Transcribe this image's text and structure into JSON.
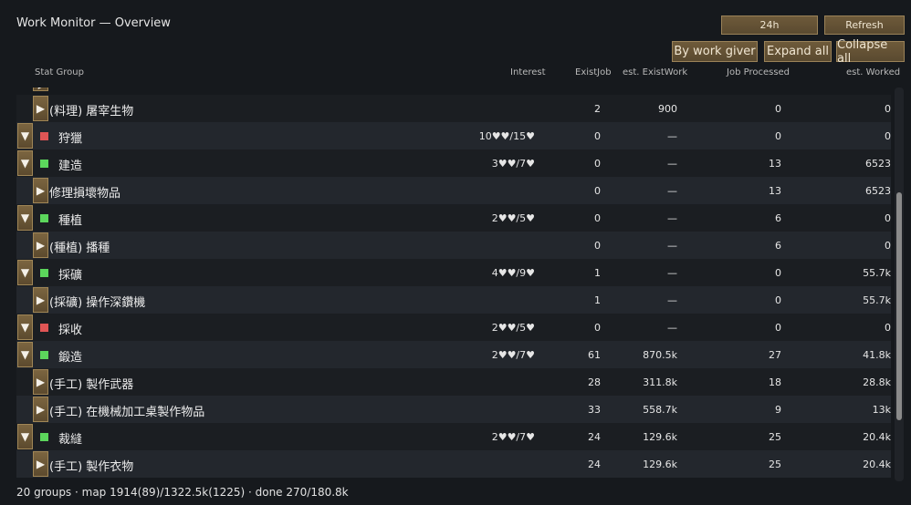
{
  "title": "Work Monitor — Overview",
  "buttons": {
    "period": "24h",
    "refresh": "Refresh",
    "by_giver": "By work giver",
    "expand": "Expand all",
    "collapse": "Collapse all"
  },
  "headers": {
    "group": "Stat Group",
    "interest": "Interest",
    "existjob": "ExistJob",
    "est_existwork": "est. ExistWork",
    "job_processed": "Job Processed",
    "est_worked": "est. Worked"
  },
  "colors": {
    "status_red": "#e05555",
    "status_green": "#5cd65c"
  },
  "rows": [
    {
      "type": "child",
      "name": "(料理) 屠宰生物",
      "existjob": "2",
      "existwork": "900",
      "processed": "0",
      "worked": "0"
    },
    {
      "type": "group",
      "status": "red",
      "name": "狩獵",
      "interest": "10♥♥/15♥",
      "existjob": "0",
      "existwork": "—",
      "processed": "0",
      "worked": "0"
    },
    {
      "type": "group",
      "status": "green",
      "name": "建造",
      "interest": "3♥♥/7♥",
      "existjob": "0",
      "existwork": "—",
      "processed": "13",
      "worked": "6523"
    },
    {
      "type": "child",
      "name": "修理損壞物品",
      "existjob": "0",
      "existwork": "—",
      "processed": "13",
      "worked": "6523"
    },
    {
      "type": "group",
      "status": "green",
      "name": "種植",
      "interest": "2♥♥/5♥",
      "existjob": "0",
      "existwork": "—",
      "processed": "6",
      "worked": "0"
    },
    {
      "type": "child",
      "name": "(種植) 播種",
      "existjob": "0",
      "existwork": "—",
      "processed": "6",
      "worked": "0"
    },
    {
      "type": "group",
      "status": "green",
      "name": "採礦",
      "interest": "4♥♥/9♥",
      "existjob": "1",
      "existwork": "—",
      "processed": "0",
      "worked": "55.7k"
    },
    {
      "type": "child",
      "name": "(採礦) 操作深鑽機",
      "existjob": "1",
      "existwork": "—",
      "processed": "0",
      "worked": "55.7k"
    },
    {
      "type": "group",
      "status": "red",
      "name": "採收",
      "interest": "2♥♥/5♥",
      "existjob": "0",
      "existwork": "—",
      "processed": "0",
      "worked": "0"
    },
    {
      "type": "group",
      "status": "green",
      "name": "鍛造",
      "interest": "2♥♥/7♥",
      "existjob": "61",
      "existwork": "870.5k",
      "processed": "27",
      "worked": "41.8k"
    },
    {
      "type": "child",
      "name": "(手工) 製作武器",
      "existjob": "28",
      "existwork": "311.8k",
      "processed": "18",
      "worked": "28.8k"
    },
    {
      "type": "child",
      "name": "(手工) 在機械加工桌製作物品",
      "existjob": "33",
      "existwork": "558.7k",
      "processed": "9",
      "worked": "13k"
    },
    {
      "type": "group",
      "status": "green",
      "name": "裁縫",
      "interest": "2♥♥/7♥",
      "existjob": "24",
      "existwork": "129.6k",
      "processed": "25",
      "worked": "20.4k"
    },
    {
      "type": "child",
      "name": "(手工) 製作衣物",
      "existjob": "24",
      "existwork": "129.6k",
      "processed": "25",
      "worked": "20.4k"
    }
  ],
  "scroll_position": 0.27,
  "footer": "20 groups · map 1914(89)/1322.5k(1225) · done 270/180.8k"
}
